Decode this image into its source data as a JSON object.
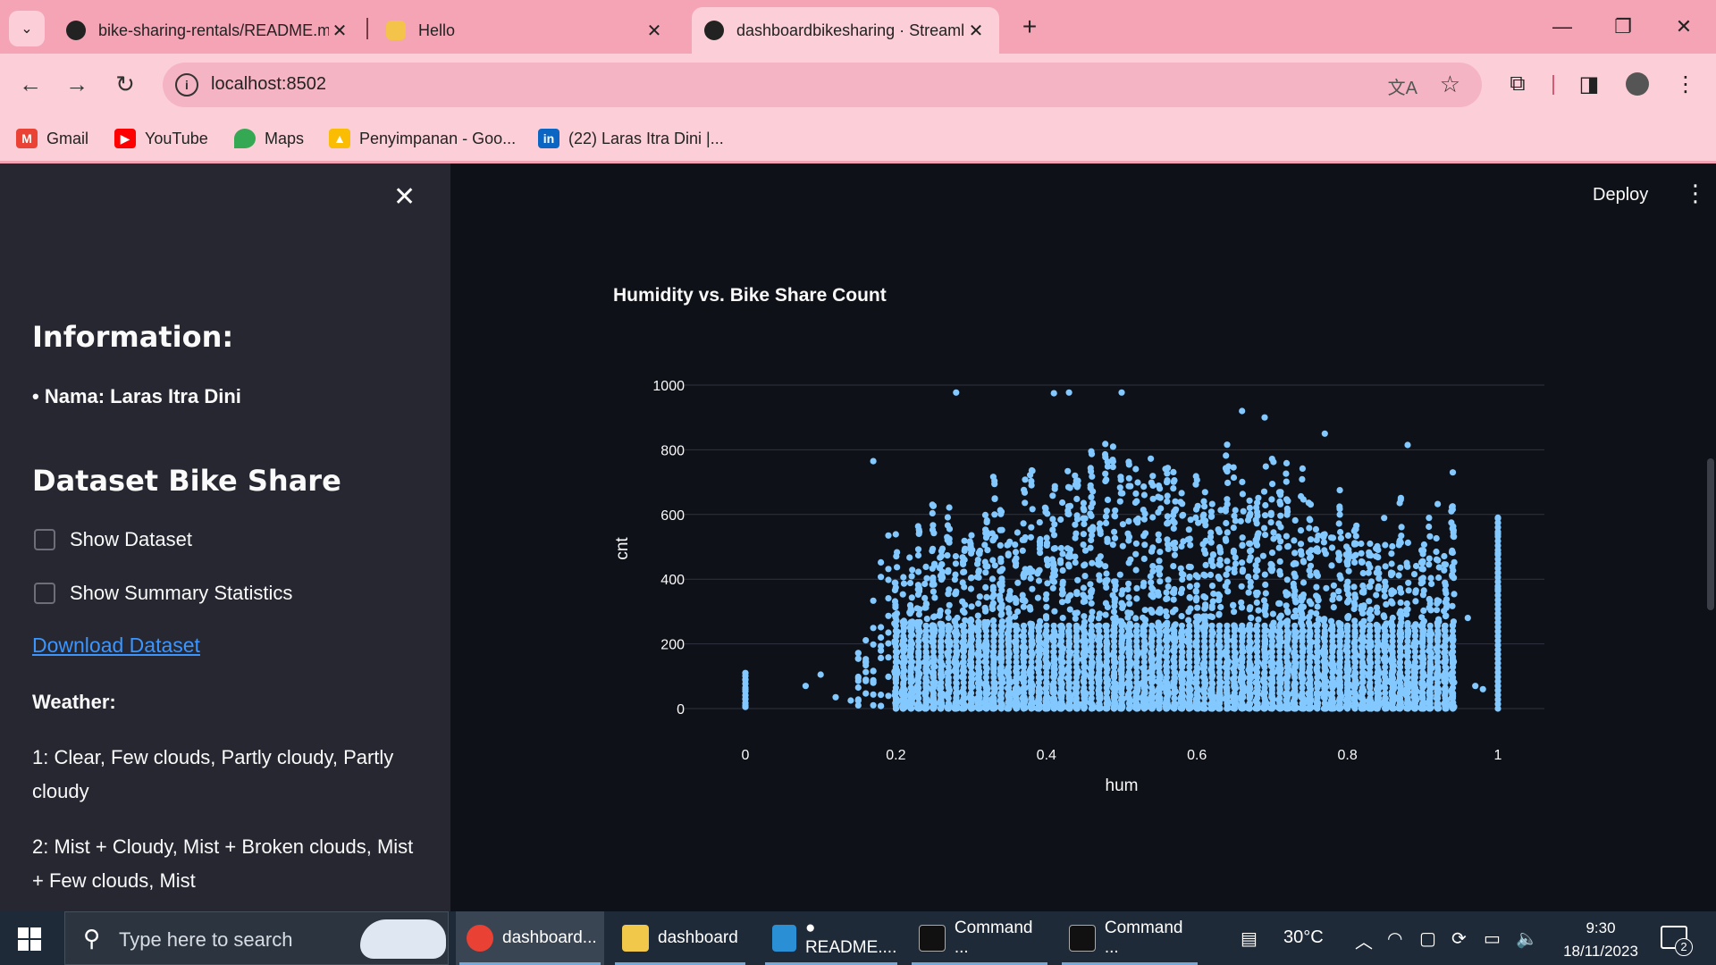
{
  "browser": {
    "tabs": [
      {
        "label": "bike-sharing-rentals/README.m",
        "icon": "github-icon"
      },
      {
        "label": "Hello",
        "icon": "wave-hand-icon"
      },
      {
        "label": "dashboardbikesharing · Streaml",
        "icon": "streamlit-crown-icon",
        "active": true
      }
    ],
    "url": "localhost:8502",
    "bookmarks": [
      {
        "label": "Gmail",
        "icon": "gmail-icon"
      },
      {
        "label": "YouTube",
        "icon": "youtube-icon"
      },
      {
        "label": "Maps",
        "icon": "maps-icon"
      },
      {
        "label": "Penyimpanan - Goo...",
        "icon": "google-drive-icon"
      },
      {
        "label": "(22) Laras Itra Dini |...",
        "icon": "linkedin-icon"
      }
    ]
  },
  "app": {
    "deploy_label": "Deploy",
    "sidebar": {
      "info_heading": "Information:",
      "name_bullet": "• Nama: Laras Itra Dini",
      "dataset_heading": "Dataset Bike Share",
      "show_dataset_label": "Show Dataset",
      "show_summary_label": "Show Summary Statistics",
      "download_link": "Download Dataset",
      "weather_heading": "Weather:",
      "weather_1": "1: Clear, Few clouds, Partly cloudy, Partly cloudy",
      "weather_2": "2: Mist + Cloudy, Mist + Broken clouds, Mist + Few clouds, Mist"
    }
  },
  "chart_data": {
    "type": "scatter",
    "title": "Humidity vs. Bike Share Count",
    "xlabel": "hum",
    "ylabel": "cnt",
    "xlim": [
      0,
      1
    ],
    "ylim": [
      0,
      1000
    ],
    "xticks": [
      "0",
      "0.2",
      "0.4",
      "0.6",
      "0.8",
      "1"
    ],
    "yticks": [
      "0",
      "200",
      "400",
      "600",
      "800",
      "1000"
    ],
    "color": "#83c9ff",
    "grid": true,
    "point_summary": "approximately 17,000 hourly observations; dense band for hum 0.2–0.94 with cnt 0–600, outliers up to about 977; isolated columns at hum 0 (cnt up to ~110) and hum 1 (cnt up to ~590)",
    "outlier_points": [
      {
        "x": 0.0,
        "y": 110
      },
      {
        "x": 0.0,
        "y": 90
      },
      {
        "x": 0.0,
        "y": 60
      },
      {
        "x": 0.0,
        "y": 30
      },
      {
        "x": 0.0,
        "y": 10
      },
      {
        "x": 0.08,
        "y": 70
      },
      {
        "x": 0.1,
        "y": 105
      },
      {
        "x": 0.12,
        "y": 35
      },
      {
        "x": 0.14,
        "y": 25
      },
      {
        "x": 0.15,
        "y": 10
      },
      {
        "x": 0.17,
        "y": 765
      },
      {
        "x": 0.28,
        "y": 977
      },
      {
        "x": 0.41,
        "y": 975
      },
      {
        "x": 0.43,
        "y": 977
      },
      {
        "x": 0.5,
        "y": 977
      },
      {
        "x": 0.66,
        "y": 920
      },
      {
        "x": 0.69,
        "y": 900
      },
      {
        "x": 0.77,
        "y": 850
      },
      {
        "x": 0.88,
        "y": 815
      },
      {
        "x": 0.94,
        "y": 730
      },
      {
        "x": 1.0,
        "y": 590
      },
      {
        "x": 1.0,
        "y": 540
      },
      {
        "x": 1.0,
        "y": 480
      },
      {
        "x": 1.0,
        "y": 420
      },
      {
        "x": 1.0,
        "y": 370
      },
      {
        "x": 0.96,
        "y": 280
      },
      {
        "x": 0.97,
        "y": 70
      },
      {
        "x": 0.98,
        "y": 60
      }
    ]
  },
  "taskbar": {
    "search_placeholder": "Type here to search",
    "apps": [
      {
        "label": "dashboard...",
        "icon": "chrome-icon"
      },
      {
        "label": "dashboard",
        "icon": "folder-icon"
      },
      {
        "label": "● README....",
        "icon": "vscode-icon"
      },
      {
        "label": "Command ...",
        "icon": "cmd-icon"
      },
      {
        "label": "Command ...",
        "icon": "cmd-icon"
      }
    ],
    "weather": "30°C",
    "time": "9:30",
    "date": "18/11/2023",
    "notification_count": "2"
  }
}
